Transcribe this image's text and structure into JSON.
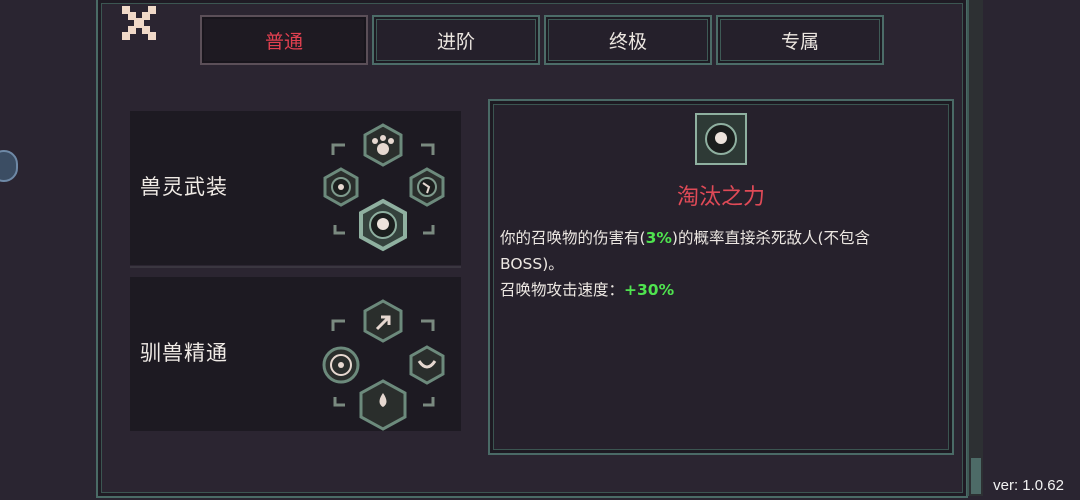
{
  "tabs": [
    {
      "label": "普通",
      "active": true
    },
    {
      "label": "进阶",
      "active": false
    },
    {
      "label": "终极",
      "active": false
    },
    {
      "label": "专属",
      "active": false
    }
  ],
  "skills": [
    {
      "name": "兽灵武装",
      "icons": [
        "paw-icon",
        "flame-rune-icon",
        "claw-rune-icon",
        "skull-rune-icon"
      ]
    },
    {
      "name": "驯兽精通",
      "icons": [
        "arrow-target-icon",
        "circle-rune-icon",
        "fang-rune-icon",
        "drops-rune-icon"
      ]
    }
  ],
  "detail": {
    "icon": "skull-rune-icon",
    "title": "淘汰之力",
    "desc_line1_prefix": "你的召唤物的伤害有(",
    "desc_line1_highlight": "3%",
    "desc_line1_suffix": ")的概率直接杀死敌人(不包含",
    "desc_line2": "BOSS)。",
    "desc_line3_prefix": "召唤物攻击速度：",
    "desc_line3_highlight": "+30%"
  },
  "version": "ver: 1.0.62",
  "colors": {
    "active_tab": "#e04050",
    "highlight": "#4fe34f",
    "frame": "#4a6b66",
    "title": "#e04a57"
  }
}
